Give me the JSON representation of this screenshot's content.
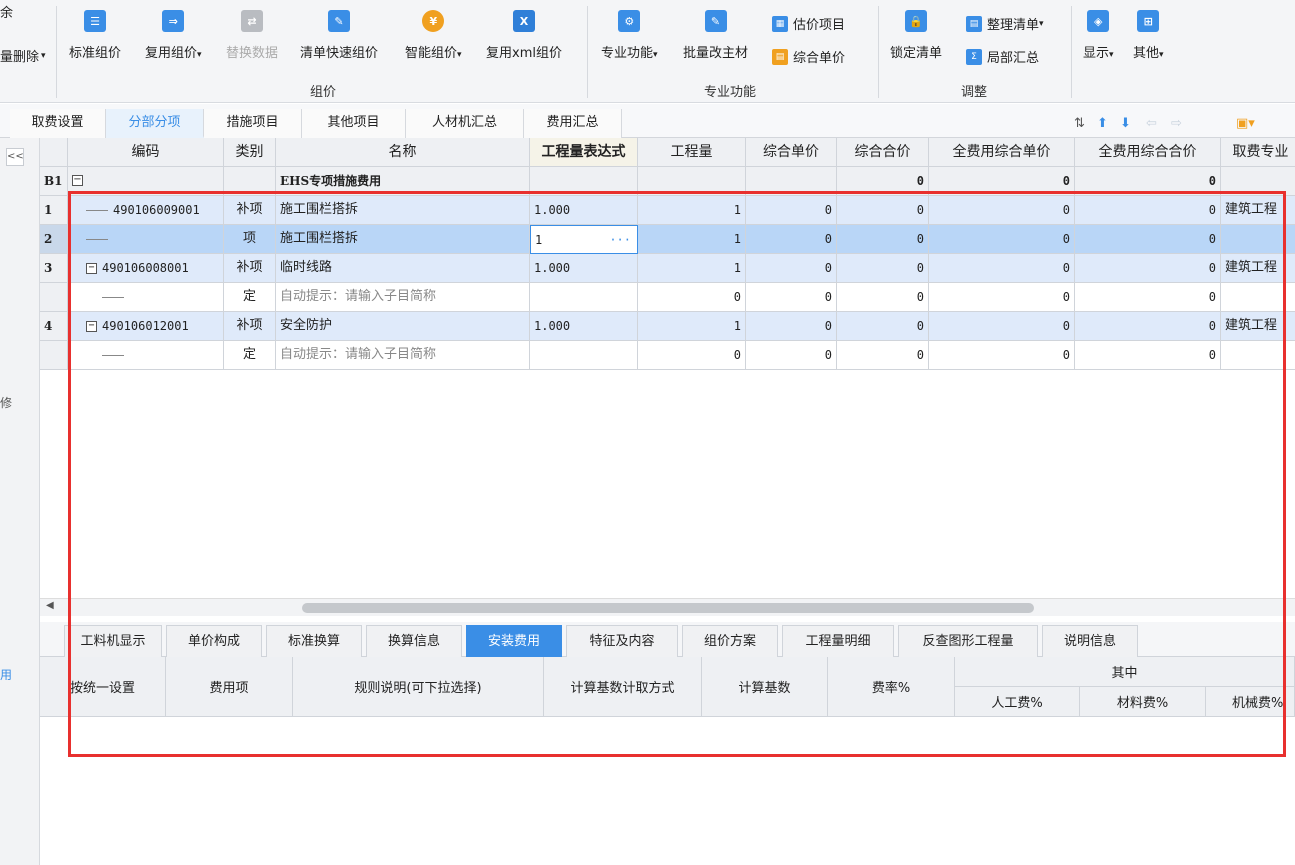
{
  "ribbon": {
    "partial_left_top": "余",
    "partial_left_bottom": "量删除",
    "buttons": {
      "standard_price": "标准组价",
      "reuse_price": "复用组价",
      "replace_data": "替换数据",
      "quick_price": "清单快速组价",
      "smart_price": "智能组价",
      "reuse_xml": "复用xml组价",
      "special_func": "专业功能",
      "batch_material": "批量改主材",
      "estimate_item": "估价项目",
      "composite_price": "综合单价",
      "lock_list": "锁定清单",
      "organize_list": "整理清单",
      "partial_summary": "局部汇总",
      "display": "显示",
      "other": "其他"
    },
    "groups": {
      "pricing": "组价",
      "special": "专业功能",
      "adjust": "调整"
    }
  },
  "tabs": [
    {
      "label": "取费设置",
      "active": false
    },
    {
      "label": "分部分项",
      "active": true
    },
    {
      "label": "措施项目",
      "active": false
    },
    {
      "label": "其他项目",
      "active": false
    },
    {
      "label": "人材机汇总",
      "active": false
    },
    {
      "label": "费用汇总",
      "active": false
    }
  ],
  "grid": {
    "headers": {
      "code": "编码",
      "type": "类别",
      "name": "名称",
      "qty_expr": "工程量表达式",
      "qty": "工程量",
      "unit_price": "综合单价",
      "total_price": "综合合价",
      "full_unit": "全费用综合单价",
      "full_total": "全费用综合合价",
      "fee_specialty": "取费专业"
    },
    "group_row": {
      "id": "B1",
      "expand": "−",
      "name": "EHS专项措施费用",
      "total_price": "0",
      "full_unit": "0",
      "full_total": "0"
    },
    "rows": [
      {
        "no": "1",
        "code": "490106009001",
        "type": "补项",
        "name": "施工围栏搭拆",
        "expr": "1.000",
        "qty": "1",
        "unit": "0",
        "total": "0",
        "full_unit": "0",
        "full_total": "0",
        "specialty": "建筑工程"
      },
      {
        "no": "2",
        "code": "",
        "type": "项",
        "name": "施工围栏搭拆",
        "expr": "1",
        "qty": "1",
        "unit": "0",
        "total": "0",
        "full_unit": "0",
        "full_total": "0",
        "specialty": ""
      },
      {
        "no": "3",
        "code": "490106008001",
        "type": "补项",
        "name": "临时线路",
        "expr": "1.000",
        "qty": "1",
        "unit": "0",
        "total": "0",
        "full_unit": "0",
        "full_total": "0",
        "specialty": "建筑工程"
      },
      {
        "no": "",
        "code": "",
        "type": "定",
        "name": "自动提示：请输入子目简称",
        "expr": "",
        "qty": "0",
        "unit": "0",
        "total": "0",
        "full_unit": "0",
        "full_total": "0",
        "specialty": ""
      },
      {
        "no": "4",
        "code": "490106012001",
        "type": "补项",
        "name": "安全防护",
        "expr": "1.000",
        "qty": "1",
        "unit": "0",
        "total": "0",
        "full_unit": "0",
        "full_total": "0",
        "specialty": "建筑工程"
      },
      {
        "no": "",
        "code": "",
        "type": "定",
        "name": "自动提示：请输入子目简称",
        "expr": "",
        "qty": "0",
        "unit": "0",
        "total": "0",
        "full_unit": "0",
        "full_total": "0",
        "specialty": ""
      }
    ],
    "ellipsis": "···"
  },
  "subtabs": [
    {
      "label": "工料机显示",
      "active": false
    },
    {
      "label": "单价构成",
      "active": false
    },
    {
      "label": "标准换算",
      "active": false
    },
    {
      "label": "换算信息",
      "active": false
    },
    {
      "label": "安装费用",
      "active": true
    },
    {
      "label": "特征及内容",
      "active": false
    },
    {
      "label": "组价方案",
      "active": false
    },
    {
      "label": "工程量明细",
      "active": false
    },
    {
      "label": "反查图形工程量",
      "active": false
    },
    {
      "label": "说明信息",
      "active": false
    }
  ],
  "subgrid": {
    "headers": {
      "unified": "按统一设置",
      "fee_item": "费用项",
      "rule": "规则说明(可下拉选择)",
      "calc_method": "计算基数计取方式",
      "calc_base": "计算基数",
      "rate": "费率%",
      "of_which": "其中",
      "labor": "人工费%",
      "material": "材料费%",
      "machine": "机械费%"
    }
  },
  "left_strip": {
    "collapse": "<<",
    "char1": "修",
    "char2": "用"
  },
  "colors": {
    "accent": "#3a8ee6",
    "highlight_box": "#e8302e",
    "selected_row": "#b9d6f7"
  }
}
